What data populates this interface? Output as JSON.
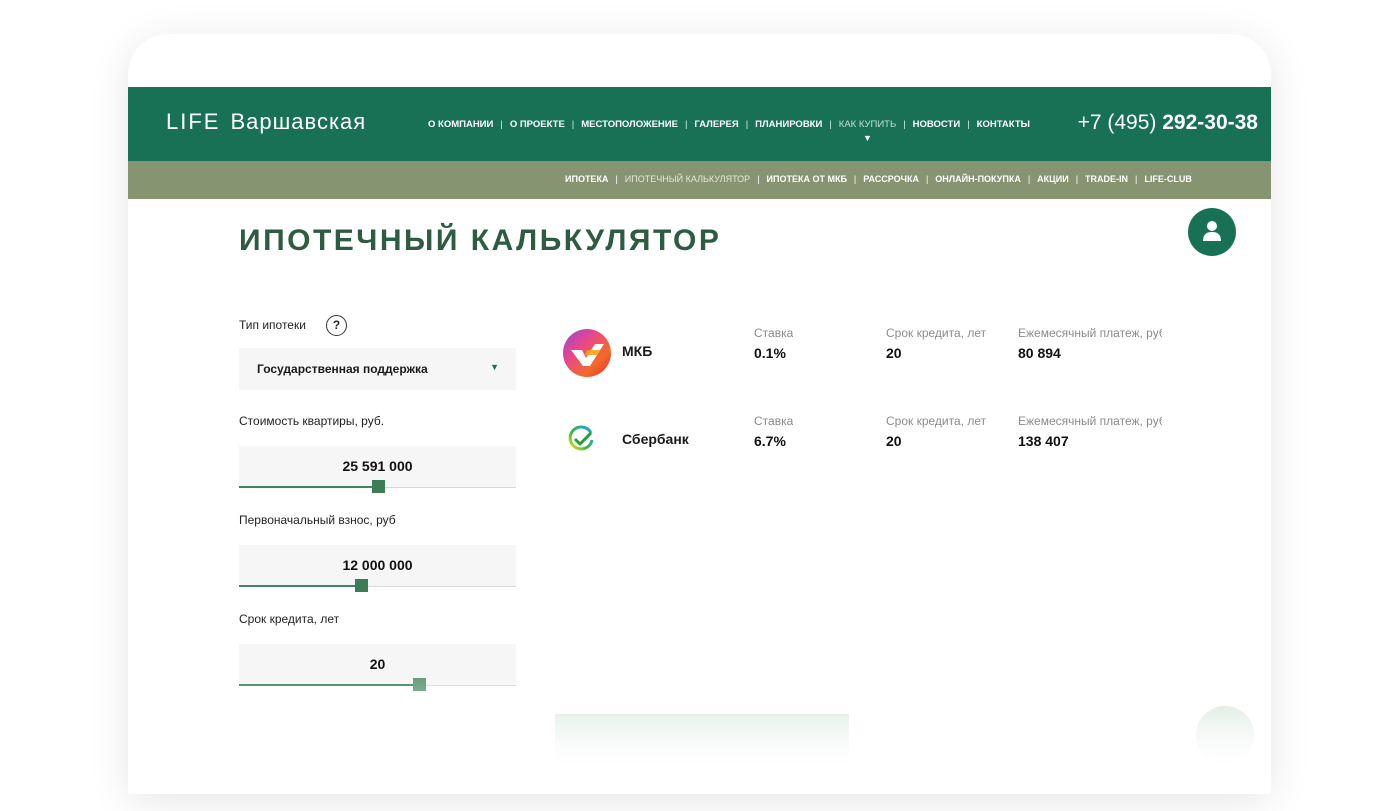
{
  "brand": {
    "name_latin": "LIFE",
    "name_cyr": "Варшавская"
  },
  "nav": {
    "items": [
      {
        "label": "О КОМПАНИИ",
        "active": false
      },
      {
        "label": "О ПРОЕКТЕ",
        "active": false
      },
      {
        "label": "МЕСТОПОЛОЖЕНИЕ",
        "active": false
      },
      {
        "label": "ГАЛЕРЕЯ",
        "active": false
      },
      {
        "label": "ПЛАНИРОВКИ",
        "active": false
      },
      {
        "label": "КАК КУПИТЬ",
        "active": true
      },
      {
        "label": "НОВОСТИ",
        "active": false
      },
      {
        "label": "КОНТАКТЫ",
        "active": false
      }
    ],
    "separator": "|",
    "active_caret": "▼"
  },
  "phone": {
    "code": "+7 (495)",
    "number": "292-30-38"
  },
  "subnav": {
    "items": [
      {
        "label": "ИПОТЕКА",
        "active": false
      },
      {
        "label": "ИПОТЕЧНЫЙ КАЛЬКУЛЯТОР",
        "active": true
      },
      {
        "label": "ИПОТЕКА ОТ МКБ",
        "active": false
      },
      {
        "label": "РАССРОЧКА",
        "active": false
      },
      {
        "label": "ОНЛАЙН-ПОКУПКА",
        "active": false
      },
      {
        "label": "АКЦИИ",
        "active": false
      },
      {
        "label": "TRADE-IN",
        "active": false
      },
      {
        "label": "LIFE-CLUB",
        "active": false
      }
    ],
    "separator": "|"
  },
  "page_title": "ИПОТЕЧНЫЙ КАЛЬКУЛЯТОР",
  "form": {
    "mortgage_type": {
      "label": "Тип ипотеки",
      "help": "?",
      "value": "Государственная поддержка",
      "arrow": "▼"
    },
    "price": {
      "label": "Стоимость квартиры, руб.",
      "value": "25 591 000",
      "slider_fraction": 0.5
    },
    "down_payment": {
      "label": "Первоначальный взнос, руб",
      "value": "12 000 000",
      "slider_fraction": 0.44
    },
    "term": {
      "label": "Срок кредита, лет",
      "value": "20",
      "slider_fraction": 0.65
    }
  },
  "banks": [
    {
      "name": "МКБ",
      "rate_label": "Ставка",
      "rate": "0.1%",
      "term_label": "Срок кредита, лет",
      "term": "20",
      "payment_label": "Ежемесячный платеж, руб",
      "payment": "80 894"
    },
    {
      "name": "Сбербанк",
      "rate_label": "Ставка",
      "rate": "6.7%",
      "term_label": "Срок кредита, лет",
      "term": "20",
      "payment_label": "Ежемесячный платеж, руб",
      "payment": "138 407"
    }
  ],
  "colors": {
    "primary_green": "#187155",
    "olive_bar": "#879472",
    "title_green": "#2e5c43",
    "slider_green": "#3b7e56"
  },
  "icons": {
    "profile": "user-icon",
    "help": "question-icon",
    "mkb_logo": "mkb-logo",
    "sber_logo": "sberbank-logo"
  }
}
